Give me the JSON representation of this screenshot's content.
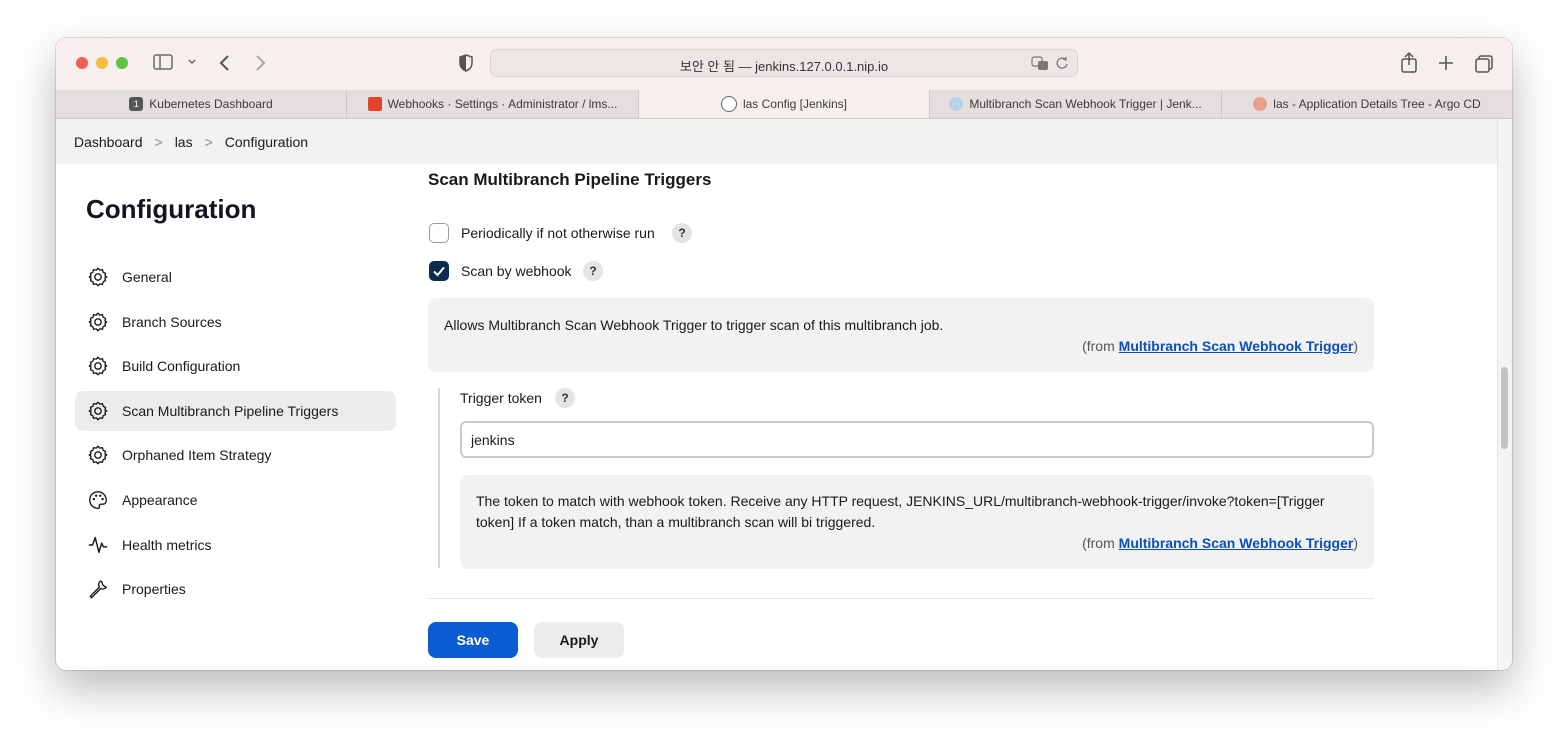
{
  "browser": {
    "address": "보안 안 됨 — jenkins.127.0.0.1.nip.io",
    "tabs": [
      {
        "title": "Kubernetes Dashboard",
        "favicon": "kubernetes-icon",
        "active": false
      },
      {
        "title": "Webhooks · Settings · Administrator / lms...",
        "favicon": "gitlab-icon",
        "active": false
      },
      {
        "title": "las Config [Jenkins]",
        "favicon": "jenkins-icon",
        "active": true
      },
      {
        "title": "Multibranch Scan Webhook Trigger | Jenk...",
        "favicon": "jenkins-plugin-icon",
        "active": false
      },
      {
        "title": "las - Application Details Tree - Argo CD",
        "favicon": "argo-icon",
        "active": false
      }
    ]
  },
  "breadcrumb": {
    "items": [
      "Dashboard",
      "las",
      "Configuration"
    ],
    "separator": ">"
  },
  "sidebar": {
    "title": "Configuration",
    "items": [
      {
        "label": "General",
        "icon": "gear-icon"
      },
      {
        "label": "Branch Sources",
        "icon": "gear-icon"
      },
      {
        "label": "Build Configuration",
        "icon": "gear-icon"
      },
      {
        "label": "Scan Multibranch Pipeline Triggers",
        "icon": "gear-icon",
        "active": true
      },
      {
        "label": "Orphaned Item Strategy",
        "icon": "gear-icon"
      },
      {
        "label": "Appearance",
        "icon": "palette-icon"
      },
      {
        "label": "Health metrics",
        "icon": "pulse-icon"
      },
      {
        "label": "Properties",
        "icon": "wrench-icon"
      }
    ]
  },
  "main": {
    "section_title": "Scan Multibranch Pipeline Triggers",
    "periodic": {
      "label": "Periodically if not otherwise run",
      "checked": false,
      "help": "?"
    },
    "webhook": {
      "label": "Scan by webhook",
      "checked": true,
      "help": "?"
    },
    "webhook_desc": {
      "text": "Allows Multibranch Scan Webhook Trigger to trigger scan of this multibranch job.",
      "from_prefix": "(from ",
      "from_link": "Multibranch Scan Webhook Trigger",
      "from_suffix": ")"
    },
    "token": {
      "label": "Trigger token",
      "help": "?",
      "value": "jenkins"
    },
    "token_desc": {
      "text": "The token to match with webhook token. Receive any HTTP request, JENKINS_URL/multibranch-webhook-trigger/invoke?token=[Trigger token] If a token match, than a multibranch scan will bi triggered.",
      "from_prefix": "(from ",
      "from_link": "Multibranch Scan Webhook Trigger",
      "from_suffix": ")"
    }
  },
  "actions": {
    "save_label": "Save",
    "apply_label": "Apply"
  },
  "colors": {
    "primary": "#0b5bd3",
    "checkbox_checked": "#0c2b4f",
    "link": "#0b4fb8"
  }
}
